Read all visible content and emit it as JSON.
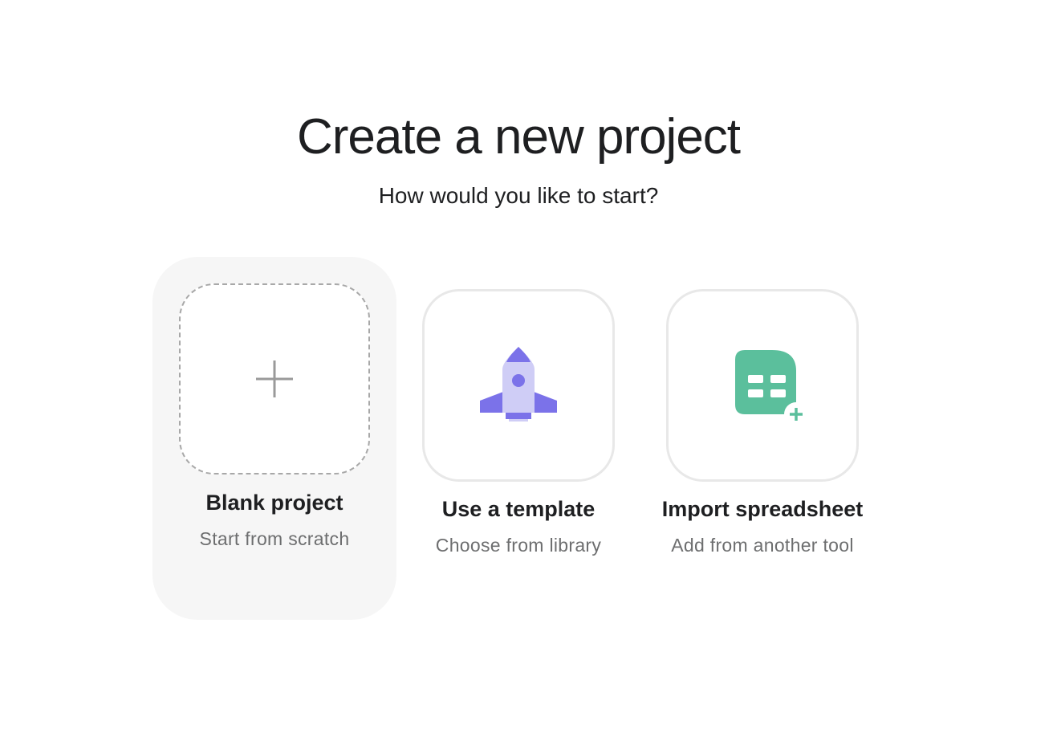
{
  "header": {
    "title": "Create a new project",
    "subtitle": "How would you like to start?"
  },
  "options": [
    {
      "label": "Blank project",
      "description": "Start from scratch",
      "icon": "plus-icon",
      "selected": true
    },
    {
      "label": "Use a template",
      "description": "Choose from library",
      "icon": "rocket-icon",
      "selected": false
    },
    {
      "label": "Import spreadsheet",
      "description": "Add from another tool",
      "icon": "spreadsheet-import-icon",
      "selected": false
    }
  ],
  "colors": {
    "rocket_body": "#cfcdf6",
    "rocket_accent": "#7b72e9",
    "spreadsheet": "#5bbf9c",
    "plus_icon": "#9a9a9a",
    "selected_background": "#f6f6f6"
  }
}
